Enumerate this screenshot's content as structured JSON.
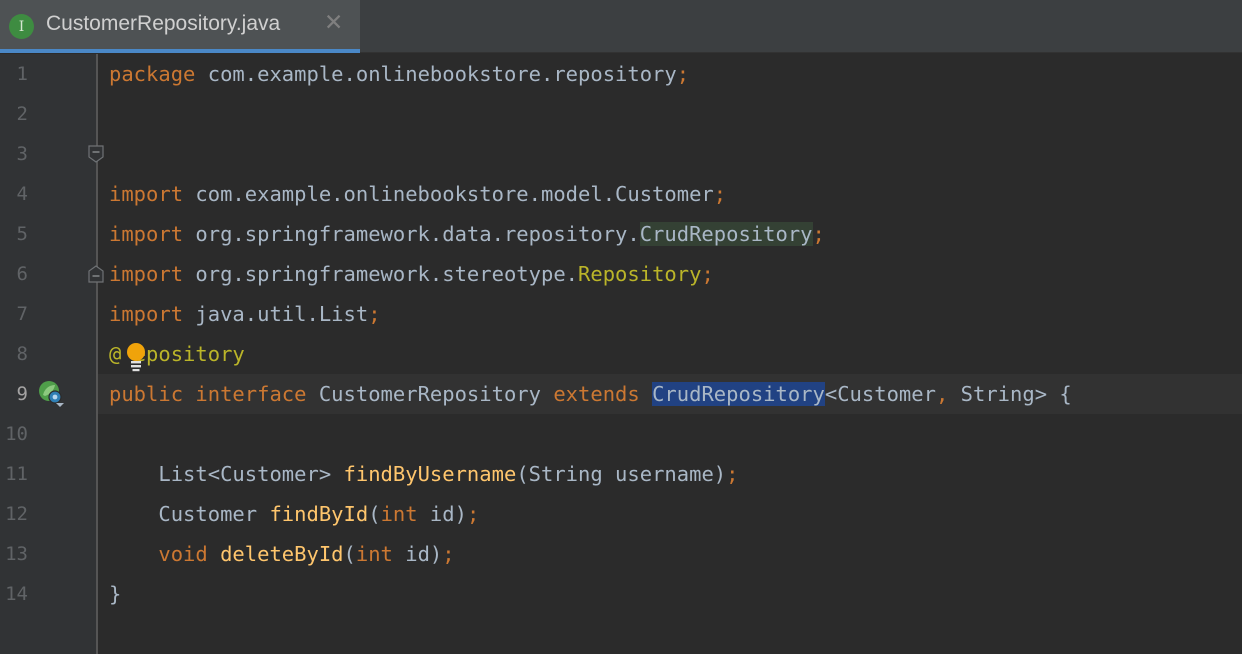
{
  "tab": {
    "icon_letter": "I",
    "title": "CustomerRepository.java",
    "close_glyph": "✕"
  },
  "gutter": {
    "line_numbers": [
      "1",
      "2",
      "3",
      "4",
      "5",
      "6",
      "7",
      "8",
      "9",
      "10",
      "11",
      "12",
      "13",
      "14"
    ],
    "active_line": "9"
  },
  "icons": {
    "fold_markers": "fold-icon",
    "intention_bulb": "lightbulb-icon",
    "bean_gutter": "spring-bean-icon"
  },
  "code": {
    "l1": {
      "kw": "package",
      "pkg": " com.example.onlinebookstore.repository",
      "semi": ";"
    },
    "l3": {
      "kw": "import",
      "path": " com.example.onlinebookstore.model.Customer",
      "semi": ";"
    },
    "l4": {
      "kw": "import",
      "path": " org.springframework.data.repository.",
      "cls": "CrudRepository",
      "semi": ";"
    },
    "l5": {
      "kw": "import",
      "path": " org.springframework.stereotype.",
      "cls": "Repository",
      "semi": ";"
    },
    "l6": {
      "kw": "import",
      "path": " java.util.List",
      "semi": ";"
    },
    "l8": {
      "ann_at": "@",
      "ann_rest": "epository"
    },
    "l9": {
      "kw1": "public",
      "kw2": " interface",
      "name": " CustomerRepository ",
      "kw3": "extends ",
      "sel": "CrudRepository",
      "gen1": "<Customer",
      "comma": ",",
      "gen2": " String> {"
    },
    "l11": {
      "indent": "    ",
      "type": "List<Customer> ",
      "fn": "findByUsername",
      "args": "(String username)",
      "semi": ";"
    },
    "l12": {
      "indent": "    ",
      "type": "Customer ",
      "fn": "findById",
      "open": "(",
      "kw": "int",
      "arg": " id)",
      "semi": ";"
    },
    "l13": {
      "indent": "    ",
      "kw1": "void ",
      "fn": "deleteById",
      "open": "(",
      "kw": "int",
      "arg": " id)",
      "semi": ";"
    },
    "l14": {
      "brace": "}"
    }
  }
}
